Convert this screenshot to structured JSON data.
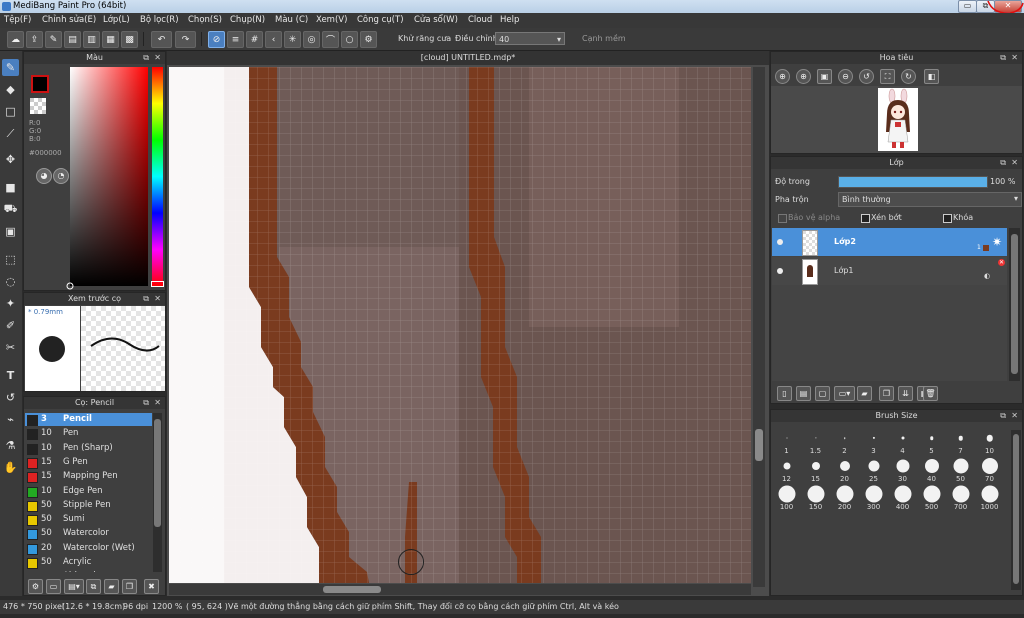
{
  "window": {
    "title": "MediBang Paint Pro (64bit)",
    "buttons": {
      "minimize": "▭",
      "restore": "⧉",
      "close": "✕"
    }
  },
  "menu": [
    "Tệp(F)",
    "Chỉnh sửa(E)",
    "Lớp(L)",
    "Bộ lọc(R)",
    "Chọn(S)",
    "Chụp(N)",
    "Màu (C)",
    "Xem(V)",
    "Công cụ(T)",
    "Cửa sổ(W)",
    "Cloud",
    "Help"
  ],
  "toolbar": {
    "antialias_label": "Khử răng cưa",
    "adjust_label": "Điều chỉnh",
    "adjust_value": "40",
    "snap_label": "Cạnh mềm"
  },
  "color_panel": {
    "title": "Màu",
    "r": "R:0",
    "g": "G:0",
    "b": "B:0",
    "hex": "#000000",
    "foreground": "#000000",
    "accent": "#cc1111"
  },
  "preview_panel": {
    "title": "Xem trước cọ",
    "size": "* 0.79mm"
  },
  "brush_panel": {
    "title": "Cọ: Pencil",
    "brushes": [
      {
        "size": "3",
        "name": "Pencil",
        "color": "#222222"
      },
      {
        "size": "10",
        "name": "Pen",
        "color": "#222222"
      },
      {
        "size": "10",
        "name": "Pen (Sharp)",
        "color": "#222222"
      },
      {
        "size": "15",
        "name": "G Pen",
        "color": "#dd2222"
      },
      {
        "size": "15",
        "name": "Mapping Pen",
        "color": "#dd2222"
      },
      {
        "size": "10",
        "name": "Edge Pen",
        "color": "#22aa22"
      },
      {
        "size": "50",
        "name": "Stipple Pen",
        "color": "#e8c800"
      },
      {
        "size": "50",
        "name": "Sumi",
        "color": "#e8c800"
      },
      {
        "size": "50",
        "name": "Watercolor",
        "color": "#3399dd"
      },
      {
        "size": "20",
        "name": "Watercolor (Wet)",
        "color": "#3399dd"
      },
      {
        "size": "50",
        "name": "Acrylic",
        "color": "#e8c800"
      },
      {
        "size": "",
        "name": "Airbrush",
        "color": "#e8c800"
      }
    ]
  },
  "document": {
    "tab": "[cloud] UNTITLED.mdp*"
  },
  "navigator": {
    "title": "Hoa tiêu"
  },
  "layer_panel": {
    "title": "Lớp",
    "opacity_label": "Độ trong",
    "opacity_value": "100 %",
    "opacity_fraction": 1.0,
    "blend_label": "Pha trộn",
    "blend_value": "Bình thường",
    "protect_alpha": "Bảo vệ alpha",
    "clipping": "Xén bớt",
    "lock": "Khóa",
    "layers": [
      {
        "name": "Lớp2",
        "selected": true
      },
      {
        "name": "Lớp1",
        "selected": false
      }
    ]
  },
  "brush_size_panel": {
    "title": "Brush Size",
    "sizes": [
      "1",
      "1.5",
      "2",
      "3",
      "4",
      "5",
      "7",
      "10",
      "12",
      "15",
      "20",
      "25",
      "30",
      "40",
      "50",
      "70",
      "100",
      "150",
      "200",
      "300",
      "400",
      "500",
      "700",
      "1000"
    ]
  },
  "status": {
    "dimensions": "476 * 750 pixel",
    "physical": "(12.6 * 19.8cm)",
    "dpi": "96 dpi",
    "zoom": "1200 %",
    "cursor": "( 95, 624 )",
    "hint": "Vẽ một đường thẳng bằng cách giữ phím Shift, Thay đổi cỡ cọ bằng cách giữ phím Ctrl, Alt và kéo"
  }
}
